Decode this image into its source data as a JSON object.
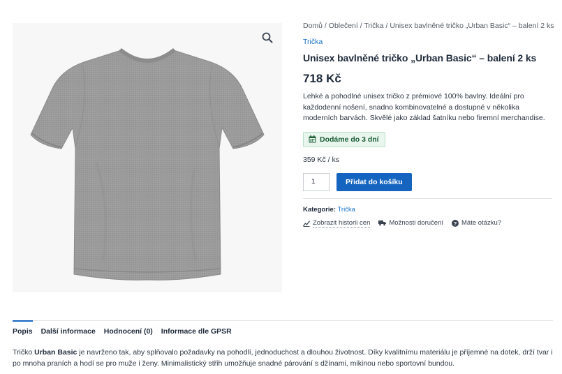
{
  "breadcrumb": [
    "Domů",
    "Oblečení",
    "Trička",
    "Unisex bavlněné tričko „Urban Basic“ – balení 2 ks"
  ],
  "breadcrumb_separator": " / ",
  "category_link": "Trička",
  "product": {
    "title": "Unisex bavlněné tričko „Urban Basic“ – balení 2 ks",
    "price": "718 Kč",
    "description": "Lehké a pohodlné unisex tričko z prémiové 100% bavlny. Ideální pro každodenní nošení, snadno kombinovatelné a dostupné v několika moderních barvách. Skvělé jako základ šatníku nebo firemní merchandise.",
    "delivery_badge": "Dodáme do 3 dní",
    "unit_price": "359 Kč / ks",
    "quantity": "1",
    "add_to_cart": "Přidat do košíku",
    "category_label": "Kategorie:",
    "category_value": "Trička",
    "image_color": "#9a9a9a"
  },
  "links": {
    "price_history": "Zobrazit historii cen",
    "delivery_options": "Možnosti doručení",
    "question": "Máte otázku?"
  },
  "tabs": [
    {
      "label": "Popis"
    },
    {
      "label": "Další informace"
    },
    {
      "label": "Hodnocení (0)"
    },
    {
      "label": "Informace dle GPSR"
    }
  ],
  "description_tab": {
    "prefix": "Tričko ",
    "brand": "Urban Basic",
    "text": " je navrženo tak, aby splňovalo požadavky na pohodlí, jednoduchost a dlouhou životnost. Díky kvalitnímu materiálu je příjemné na dotek, drží tvar i po mnoha praních a hodí se pro muže i ženy. Minimalistický střih umožňuje snadné párování s džínami, mikinou nebo sportovní bundou."
  },
  "colors": {
    "accent": "#1565c0",
    "link": "#1a73c6",
    "badge_bg": "#e9f6ee",
    "badge_text": "#1b5e36"
  },
  "icons": {
    "zoom": "search-icon",
    "badge": "calendar-icon",
    "price_history": "chart-line-icon",
    "delivery": "truck-icon",
    "question": "question-circle-icon"
  }
}
